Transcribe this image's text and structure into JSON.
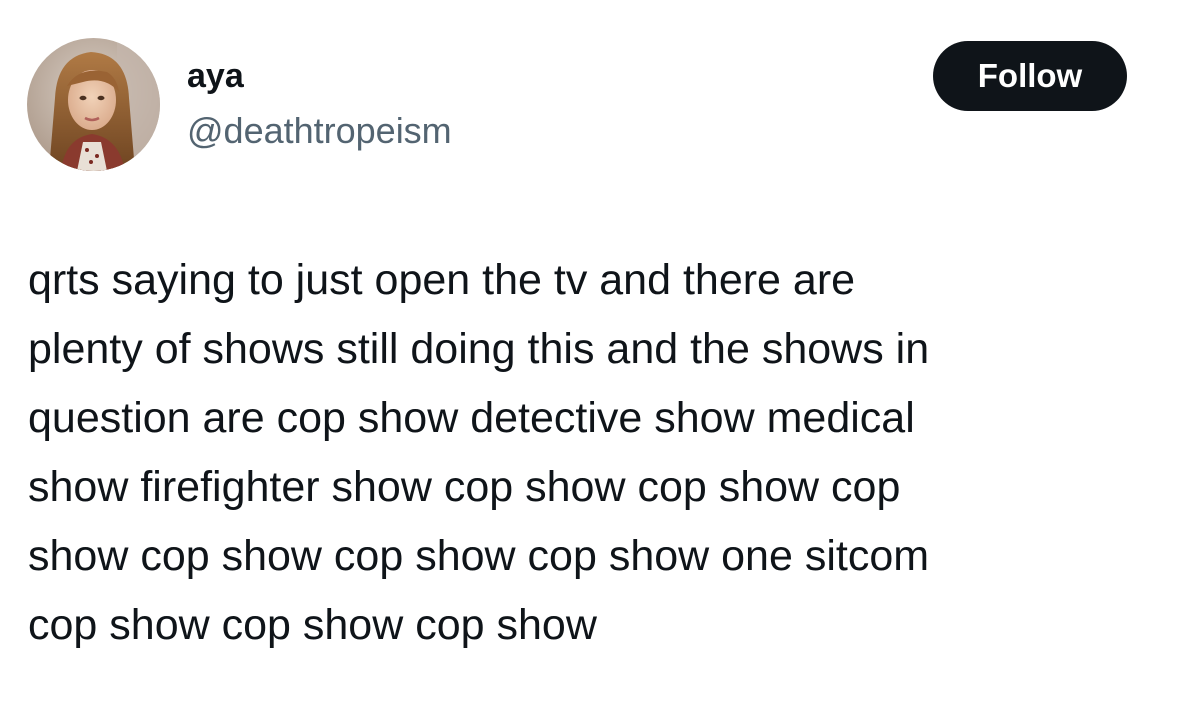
{
  "author": {
    "display_name": "aya",
    "handle": "@deathtropeism"
  },
  "follow_button": {
    "label": "Follow"
  },
  "tweet": {
    "lines": [
      "qrts saying to just open the tv and there are",
      "plenty of shows still doing this and the shows in",
      "question are cop show detective show medical",
      "show firefighter show cop show cop show cop",
      "show cop show cop show cop show one sitcom",
      "cop show cop show cop show"
    ]
  },
  "colors": {
    "text_primary": "#0f1419",
    "text_secondary": "#536471",
    "button_bg": "#0f1419",
    "button_text": "#ffffff",
    "background": "#ffffff"
  },
  "icons": {
    "avatar": "profile-photo"
  }
}
